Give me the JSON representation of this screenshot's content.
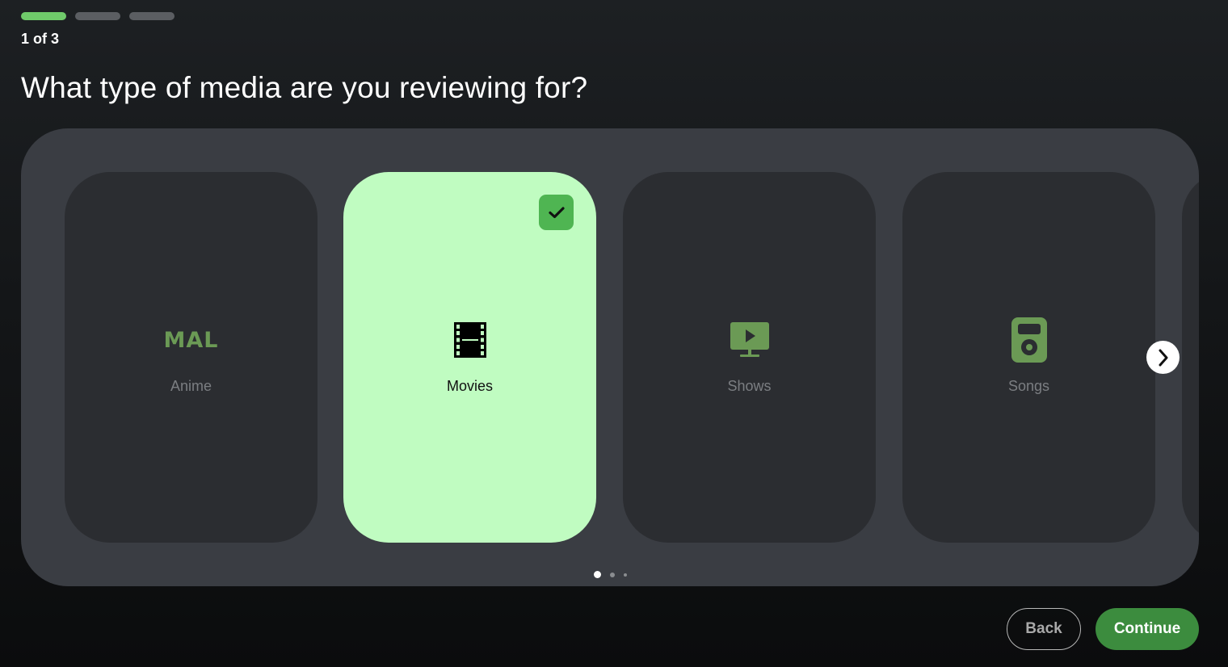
{
  "progress": {
    "steps": 3,
    "current": 1,
    "label": "1 of 3"
  },
  "question": "What type of media are you reviewing for?",
  "options": [
    {
      "label": "Anime",
      "icon": "mal-logo-icon",
      "logo_text": "MAL",
      "selected": false
    },
    {
      "label": "Movies",
      "icon": "film-icon",
      "selected": true
    },
    {
      "label": "Shows",
      "icon": "tv-play-icon",
      "selected": false
    },
    {
      "label": "Songs",
      "icon": "music-player-icon",
      "selected": false
    }
  ],
  "pagination": {
    "pages": 3,
    "current": 1
  },
  "buttons": {
    "back": "Back",
    "continue": "Continue"
  },
  "colors": {
    "accent": "#6fca6a",
    "selected_card": "#c0fcc1",
    "check_badge": "#4fb552",
    "continue_button": "#3c8c3e",
    "icon_green": "#6b9a55"
  }
}
